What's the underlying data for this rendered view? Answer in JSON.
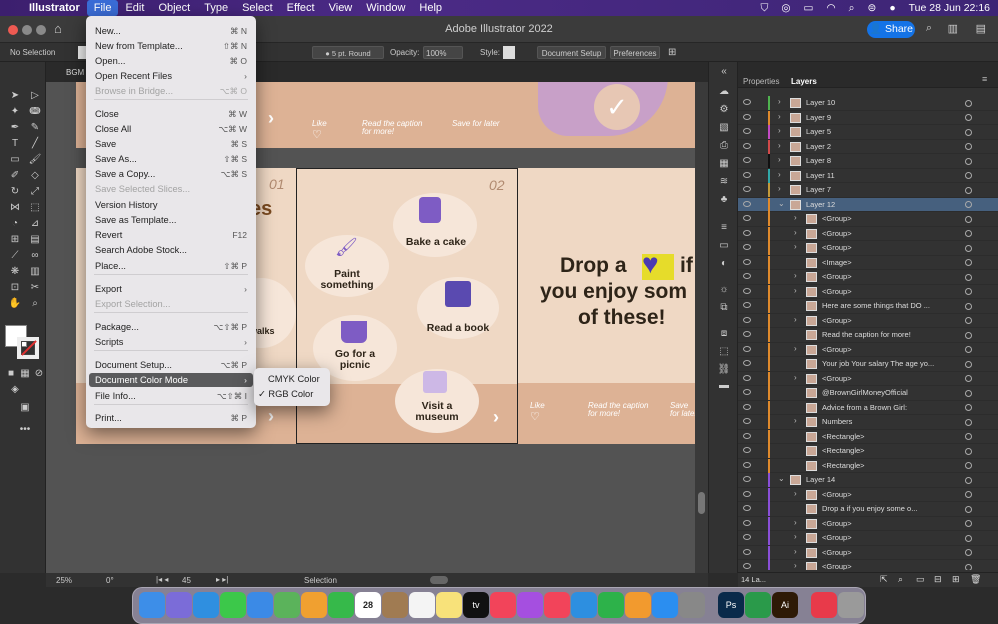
{
  "menubar": {
    "apple": "",
    "app": "Illustrator",
    "items": [
      "File",
      "Edit",
      "Object",
      "Type",
      "Select",
      "Effect",
      "View",
      "Window",
      "Help"
    ],
    "clock": "Tue 28 Jun  22:16"
  },
  "titlebar": {
    "title": "Adobe Illustrator 2022",
    "share": "Share"
  },
  "control": {
    "selection": "No Selection",
    "stroke": "5 pt. Round",
    "opacity_label": "Opacity:",
    "opacity": "100%",
    "style_label": "Style:",
    "doc_setup": "Document Setup",
    "preferences": "Preferences"
  },
  "tab": {
    "name": "BGM"
  },
  "file_menu": {
    "items": [
      {
        "label": "New...",
        "shortcut": "⌘ N",
        "state": "normal"
      },
      {
        "label": "New from Template...",
        "shortcut": "⇧⌘ N",
        "state": "normal"
      },
      {
        "label": "Open...",
        "shortcut": "⌘ O",
        "state": "normal"
      },
      {
        "label": "Open Recent Files",
        "shortcut": "›",
        "state": "normal"
      },
      {
        "label": "Browse in Bridge...",
        "shortcut": "⌥⌘ O",
        "state": "disabled"
      },
      {
        "label": "Close",
        "shortcut": "⌘ W",
        "state": "normal"
      },
      {
        "label": "Close All",
        "shortcut": "⌥⌘ W",
        "state": "normal"
      },
      {
        "label": "Save",
        "shortcut": "⌘ S",
        "state": "normal"
      },
      {
        "label": "Save As...",
        "shortcut": "⇧⌘ S",
        "state": "normal"
      },
      {
        "label": "Save a Copy...",
        "shortcut": "⌥⌘ S",
        "state": "normal"
      },
      {
        "label": "Save Selected Slices...",
        "shortcut": "",
        "state": "disabled"
      },
      {
        "label": "Version History",
        "shortcut": "",
        "state": "normal"
      },
      {
        "label": "Save as Template...",
        "shortcut": "",
        "state": "normal"
      },
      {
        "label": "Revert",
        "shortcut": "F12",
        "state": "normal"
      },
      {
        "label": "Search Adobe Stock...",
        "shortcut": "",
        "state": "normal"
      },
      {
        "label": "Place...",
        "shortcut": "⇧⌘ P",
        "state": "normal"
      },
      {
        "label": "Export",
        "shortcut": "›",
        "state": "normal"
      },
      {
        "label": "Export Selection...",
        "shortcut": "",
        "state": "disabled"
      },
      {
        "label": "Package...",
        "shortcut": "⌥⇧⌘ P",
        "state": "normal"
      },
      {
        "label": "Scripts",
        "shortcut": "›",
        "state": "normal"
      },
      {
        "label": "Document Setup...",
        "shortcut": "⌥⌘ P",
        "state": "normal"
      },
      {
        "label": "Document Color Mode",
        "shortcut": "›",
        "state": "highlighted"
      },
      {
        "label": "File Info...",
        "shortcut": "⌥⇧⌘ I",
        "state": "normal"
      },
      {
        "label": "Print...",
        "shortcut": "⌘ P",
        "state": "normal"
      }
    ]
  },
  "color_submenu": {
    "items": [
      {
        "label": "CMYK Color",
        "checked": false
      },
      {
        "label": "RGB Color",
        "checked": true
      }
    ]
  },
  "artboards": {
    "num1": "01",
    "num2": "02",
    "partial_title": "es",
    "partial_label": "walks",
    "activities": [
      "Bake a cake",
      "Paint something",
      "Read a book",
      "Go for a picnic",
      "Visit a museum"
    ],
    "like": "Like",
    "caption": "Read the caption for more!",
    "save_later": "Save for later",
    "drop_text_1": "Drop a",
    "drop_text_2": "if",
    "drop_text_3": "you enjoy som",
    "drop_text_4": "of these!"
  },
  "statusbar": {
    "zoom": "25%",
    "rotate": "0°",
    "artboard": "45",
    "mode": "Selection"
  },
  "panel": {
    "tabs": [
      "Properties",
      "Layers"
    ],
    "layers": [
      {
        "name": "Layer 10",
        "color": "#4fb34f",
        "indent": 0,
        "expand": "›"
      },
      {
        "name": "Layer 9",
        "color": "#e08a2c",
        "indent": 0,
        "expand": "›"
      },
      {
        "name": "Layer 5",
        "color": "#c44bc4",
        "indent": 0,
        "expand": "›"
      },
      {
        "name": "Layer 2",
        "color": "#d24a4a",
        "indent": 0,
        "expand": "›"
      },
      {
        "name": "Layer 8",
        "color": "#111111",
        "indent": 0,
        "expand": "›"
      },
      {
        "name": "Layer 11",
        "color": "#31a8a8",
        "indent": 0,
        "expand": "›"
      },
      {
        "name": "Layer 7",
        "color": "#c49a3a",
        "indent": 0,
        "expand": "›"
      },
      {
        "name": "Layer 12",
        "color": "#e08a2c",
        "indent": 0,
        "expand": "⌄",
        "selected": true
      },
      {
        "name": "<Group>",
        "color": "#e08a2c",
        "indent": 1,
        "expand": "›"
      },
      {
        "name": "<Group>",
        "color": "#e08a2c",
        "indent": 1,
        "expand": "›"
      },
      {
        "name": "<Group>",
        "color": "#e08a2c",
        "indent": 1,
        "expand": "›"
      },
      {
        "name": "<Image>",
        "color": "#e08a2c",
        "indent": 1,
        "expand": ""
      },
      {
        "name": "<Group>",
        "color": "#e08a2c",
        "indent": 1,
        "expand": "›"
      },
      {
        "name": "<Group>",
        "color": "#e08a2c",
        "indent": 1,
        "expand": "›"
      },
      {
        "name": "Here are some things that DO ...",
        "color": "#e08a2c",
        "indent": 1,
        "expand": ""
      },
      {
        "name": "<Group>",
        "color": "#e08a2c",
        "indent": 1,
        "expand": "›"
      },
      {
        "name": "Read the  caption for more!",
        "color": "#e08a2c",
        "indent": 1,
        "expand": ""
      },
      {
        "name": "<Group>",
        "color": "#e08a2c",
        "indent": 1,
        "expand": "›"
      },
      {
        "name": "Your job Your salary The age yo...",
        "color": "#e08a2c",
        "indent": 1,
        "expand": ""
      },
      {
        "name": "<Group>",
        "color": "#e08a2c",
        "indent": 1,
        "expand": "›"
      },
      {
        "name": "@BrownGirlMoneyOfficial",
        "color": "#e08a2c",
        "indent": 1,
        "expand": ""
      },
      {
        "name": "Advice from a Brown Girl:",
        "color": "#e08a2c",
        "indent": 1,
        "expand": ""
      },
      {
        "name": "Numbers",
        "color": "#e08a2c",
        "indent": 1,
        "expand": "›"
      },
      {
        "name": "<Rectangle>",
        "color": "#e08a2c",
        "indent": 1,
        "expand": ""
      },
      {
        "name": "<Rectangle>",
        "color": "#e08a2c",
        "indent": 1,
        "expand": ""
      },
      {
        "name": "<Rectangle>",
        "color": "#e08a2c",
        "indent": 1,
        "expand": ""
      },
      {
        "name": "Layer 14",
        "color": "#8a4fd8",
        "indent": 0,
        "expand": "⌄"
      },
      {
        "name": "<Group>",
        "color": "#8a4fd8",
        "indent": 1,
        "expand": "›"
      },
      {
        "name": "Drop a       if you enjoy some o...",
        "color": "#8a4fd8",
        "indent": 1,
        "expand": ""
      },
      {
        "name": "<Group>",
        "color": "#8a4fd8",
        "indent": 1,
        "expand": "›"
      },
      {
        "name": "<Group>",
        "color": "#8a4fd8",
        "indent": 1,
        "expand": "›"
      },
      {
        "name": "<Group>",
        "color": "#8a4fd8",
        "indent": 1,
        "expand": "›"
      },
      {
        "name": "<Group>",
        "color": "#8a4fd8",
        "indent": 1,
        "expand": "›"
      }
    ],
    "count": "14 La..."
  },
  "dock": [
    {
      "name": "finder",
      "color": "#3d8ee8"
    },
    {
      "name": "launchpad",
      "color": "#7b6cd8"
    },
    {
      "name": "safari",
      "color": "#2f8fe0"
    },
    {
      "name": "messages",
      "color": "#3cc84a"
    },
    {
      "name": "mail",
      "color": "#3b8ae6"
    },
    {
      "name": "maps",
      "color": "#5bb35b"
    },
    {
      "name": "photos",
      "color": "#f0a030"
    },
    {
      "name": "facetime",
      "color": "#36b94a"
    },
    {
      "name": "calendar",
      "color": "#ffffff",
      "label": "28"
    },
    {
      "name": "notes-brown",
      "color": "#a07b52"
    },
    {
      "name": "reminders",
      "color": "#f4f4f4"
    },
    {
      "name": "notes",
      "color": "#f8e27a"
    },
    {
      "name": "tv",
      "color": "#111111",
      "label": "tv"
    },
    {
      "name": "music",
      "color": "#f2445a"
    },
    {
      "name": "podcasts",
      "color": "#a54fe0"
    },
    {
      "name": "news",
      "color": "#f2445a"
    },
    {
      "name": "keynote",
      "color": "#2d8fe0"
    },
    {
      "name": "numbers",
      "color": "#2db24a"
    },
    {
      "name": "pages",
      "color": "#f29a2e"
    },
    {
      "name": "app-store",
      "color": "#2b8ef0"
    },
    {
      "name": "system-preferences",
      "color": "#888888"
    },
    {
      "name": "photoshop",
      "color": "#0a2a4a",
      "label": "Ps"
    },
    {
      "name": "shield",
      "color": "#2a9a4a"
    },
    {
      "name": "illustrator",
      "color": "#2e1a06",
      "label": "Ai"
    },
    {
      "name": "heart-app",
      "color": "#e83a4a"
    },
    {
      "name": "trash",
      "color": "#9a9a9a"
    }
  ]
}
